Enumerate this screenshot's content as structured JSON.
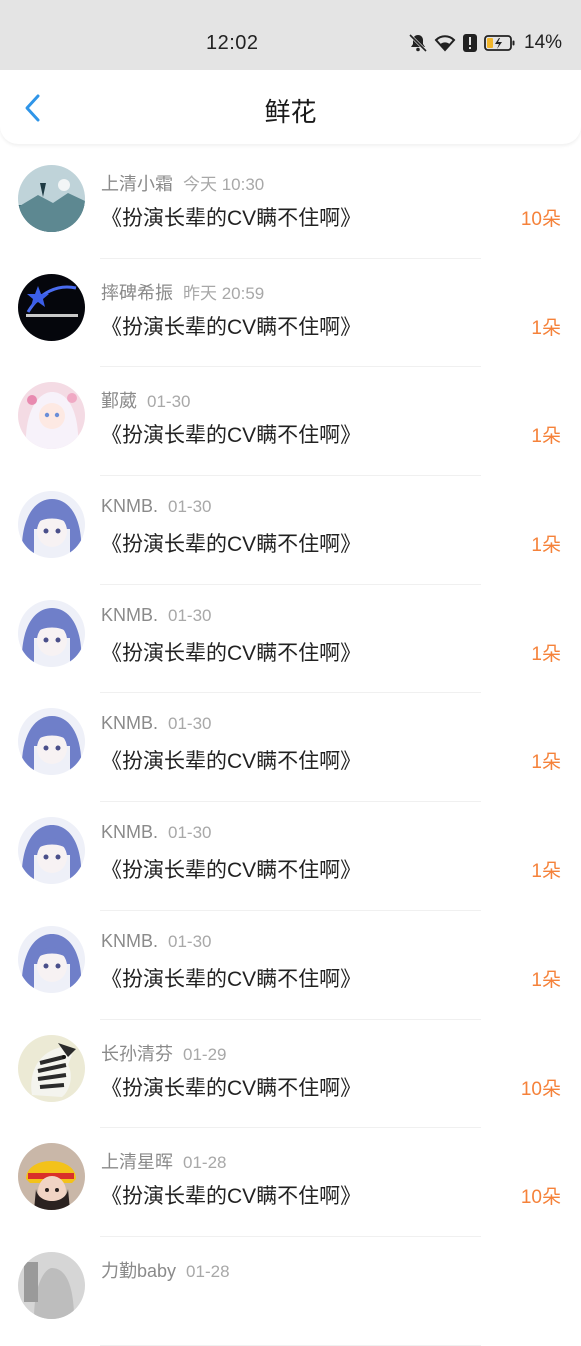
{
  "status_bar": {
    "time": "12:02",
    "battery": "14%",
    "icons": [
      "mute-bell-icon",
      "wifi-icon",
      "alert-icon",
      "battery-icon"
    ]
  },
  "header": {
    "back_icon": "chevron-left-icon",
    "title": "鲜花"
  },
  "accent_color": "#f5823a",
  "items": [
    {
      "user": "上清小霜",
      "time": "今天 10:30",
      "work": "《扮演长辈的CV瞒不住啊》",
      "count": "10朵",
      "avatar": "landscape-avatar"
    },
    {
      "user": "摔碑希振",
      "time": "昨天 20:59",
      "work": "《扮演长辈的CV瞒不住啊》",
      "count": "1朵",
      "avatar": "dark-star-avatar"
    },
    {
      "user": "鄞葳",
      "time": "01-30",
      "work": "《扮演长辈的CV瞒不住啊》",
      "count": "1朵",
      "avatar": "anime-pink-avatar"
    },
    {
      "user": "KNMB.",
      "time": "01-30",
      "work": "《扮演长辈的CV瞒不住啊》",
      "count": "1朵",
      "avatar": "anime-blue-avatar"
    },
    {
      "user": "KNMB.",
      "time": "01-30",
      "work": "《扮演长辈的CV瞒不住啊》",
      "count": "1朵",
      "avatar": "anime-blue-avatar"
    },
    {
      "user": "KNMB.",
      "time": "01-30",
      "work": "《扮演长辈的CV瞒不住啊》",
      "count": "1朵",
      "avatar": "anime-blue-avatar"
    },
    {
      "user": "KNMB.",
      "time": "01-30",
      "work": "《扮演长辈的CV瞒不住啊》",
      "count": "1朵",
      "avatar": "anime-blue-avatar"
    },
    {
      "user": "KNMB.",
      "time": "01-30",
      "work": "《扮演长辈的CV瞒不住啊》",
      "count": "1朵",
      "avatar": "anime-blue-avatar"
    },
    {
      "user": "长孙清芬",
      "time": "01-29",
      "work": "《扮演长辈的CV瞒不住啊》",
      "count": "10朵",
      "avatar": "zebra-avatar"
    },
    {
      "user": "上清星晖",
      "time": "01-28",
      "work": "《扮演长辈的CV瞒不住啊》",
      "count": "10朵",
      "avatar": "helmet-avatar"
    },
    {
      "user": "力勤baby",
      "time": "01-28",
      "work": "",
      "count": "",
      "avatar": "gray-avatar"
    }
  ]
}
